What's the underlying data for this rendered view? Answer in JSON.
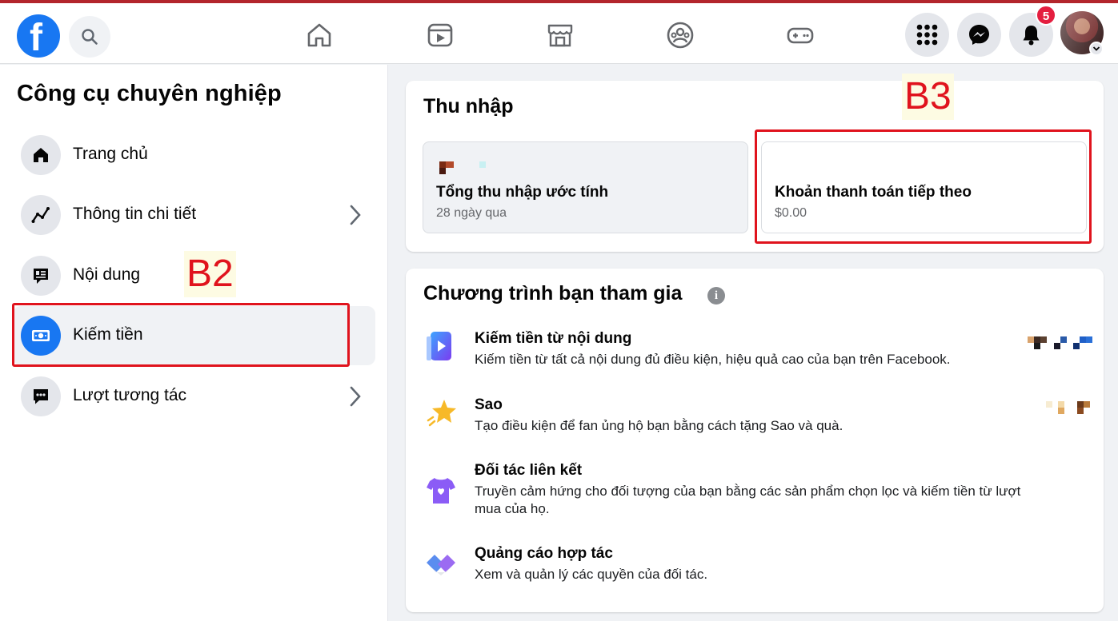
{
  "header": {
    "logo_letter": "f",
    "notifications_count": "5",
    "nav": [
      "home-icon",
      "watch-icon",
      "marketplace-icon",
      "groups-icon",
      "gaming-icon"
    ],
    "right_buttons": [
      "menu-grid-icon",
      "messenger-icon",
      "bell-icon"
    ]
  },
  "sidebar": {
    "title": "Công cụ chuyên nghiệp",
    "items": [
      {
        "label": "Trang chủ",
        "icon": "home-icon",
        "has_chevron": false
      },
      {
        "label": "Thông tin chi tiết",
        "icon": "insights-icon",
        "has_chevron": true
      },
      {
        "label": "Nội dung",
        "icon": "content-icon",
        "has_chevron": false
      },
      {
        "label": "Kiếm tiền",
        "icon": "money-icon",
        "has_chevron": false,
        "active": true
      },
      {
        "label": "Lượt tương tác",
        "icon": "chat-icon",
        "has_chevron": true
      }
    ]
  },
  "annotations": {
    "b2": "B2",
    "b3": "B3"
  },
  "income": {
    "title": "Thu nhập",
    "estimated": {
      "title": "Tổng thu nhập ước tính",
      "subtitle": "28 ngày qua"
    },
    "next_payment": {
      "title": "Khoản thanh toán tiếp theo",
      "value": "$0.00"
    }
  },
  "programs": {
    "title": "Chương trình bạn tham gia",
    "info_glyph": "i",
    "items": [
      {
        "title": "Kiếm tiền từ nội dung",
        "desc": "Kiếm tiền từ tất cả nội dung đủ điều kiện, hiệu quả cao của bạn trên Facebook.",
        "icon": "content-monetization-icon"
      },
      {
        "title": "Sao",
        "desc": "Tạo điều kiện để fan ủng hộ bạn bằng cách tặng Sao và quà.",
        "icon": "stars-icon"
      },
      {
        "title": "Đối tác liên kết",
        "desc": "Truyền cảm hứng cho đối tượng của bạn bằng các sản phẩm chọn lọc và kiếm tiền từ lượt mua của họ.",
        "icon": "affiliate-shirt-icon"
      },
      {
        "title": "Quảng cáo hợp tác",
        "desc": "Xem và quản lý các quyền của đối tác.",
        "icon": "partnership-ads-icon"
      }
    ]
  }
}
